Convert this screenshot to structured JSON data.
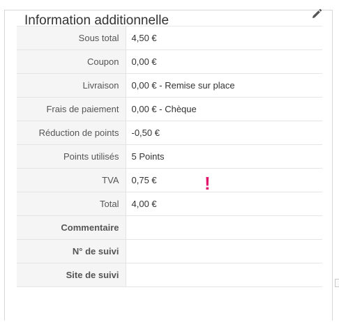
{
  "panel": {
    "title": "Information additionnelle",
    "edit_icon": "pencil-icon",
    "warning_glyph": "!",
    "warning_color": "#e0156b"
  },
  "rows": [
    {
      "label": "Sous total",
      "value": "4,50 €",
      "bold": false
    },
    {
      "label": "Coupon",
      "value": "0,00 €",
      "bold": false
    },
    {
      "label": "Livraison",
      "value": "0,00 € - Remise sur place",
      "bold": false
    },
    {
      "label": "Frais de paiement",
      "value": "0,00 € - Chèque",
      "bold": false
    },
    {
      "label": "Réduction de points",
      "value": "-0,50 €",
      "bold": false
    },
    {
      "label": "Points utilisés",
      "value": "5 Points",
      "bold": false
    },
    {
      "label": "TVA",
      "value": "0,75 €",
      "bold": false
    },
    {
      "label": "Total",
      "value": "4,00 €",
      "bold": false
    },
    {
      "label": "Commentaire",
      "value": "",
      "bold": true
    },
    {
      "label": "N° de suivi",
      "value": "",
      "bold": true
    },
    {
      "label": "Site de suivi",
      "value": "",
      "bold": true
    }
  ]
}
